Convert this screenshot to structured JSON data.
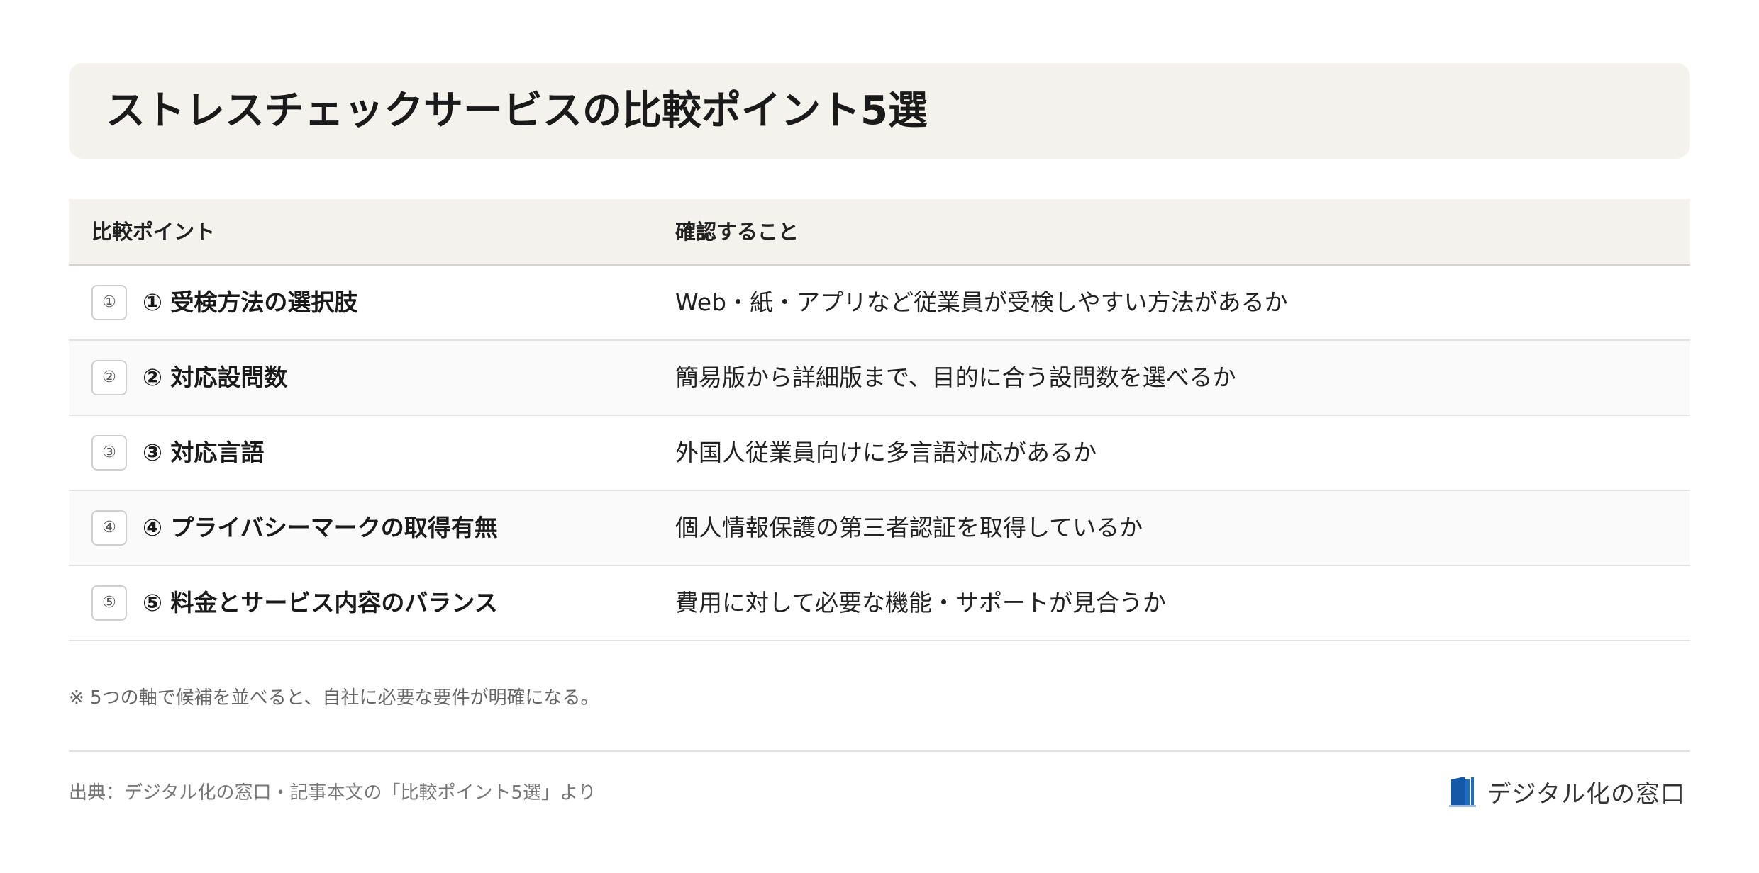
{
  "title": "ストレスチェックサービスの比較ポイント5選",
  "table": {
    "headers": [
      "比較ポイント",
      "確認すること"
    ],
    "rows": [
      {
        "num": "①",
        "point": "① 受検方法の選択肢",
        "check": "Web・紙・アプリなど従業員が受検しやすい方法があるか"
      },
      {
        "num": "②",
        "point": "② 対応設問数",
        "check": "簡易版から詳細版まで、目的に合う設問数を選べるか"
      },
      {
        "num": "③",
        "point": "③ 対応言語",
        "check": "外国人従業員向けに多言語対応があるか"
      },
      {
        "num": "④",
        "point": "④ プライバシーマークの取得有無",
        "check": "個人情報保護の第三者認証を取得しているか"
      },
      {
        "num": "⑤",
        "point": "⑤ 料金とサービス内容のバランス",
        "check": "費用に対して必要な機能・サポートが見合うか"
      }
    ]
  },
  "note": "※ 5つの軸で候補を並べると、自社に必要な要件が明確になる。",
  "footer": {
    "source": "出典：デジタル化の窓口・記事本文の「比較ポイント5選」より",
    "brand": "デジタル化の窓口",
    "brand_icon": "door-logo-icon",
    "brand_color": "#1a6fc9"
  },
  "colors": {
    "title_bg": "#f4f2ec",
    "header_bg": "#f4f2ec",
    "alt_row_bg": "#fafafa"
  }
}
